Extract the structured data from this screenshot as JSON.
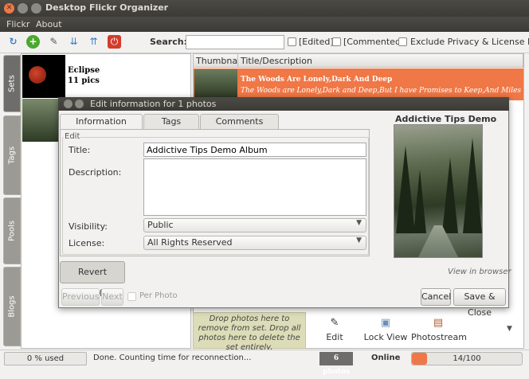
{
  "window": {
    "title": "Desktop Flickr Organizer"
  },
  "menu": {
    "items": [
      "Flickr",
      "About"
    ]
  },
  "toolbar": {
    "search_label": "Search:",
    "search_value": "",
    "filters": [
      {
        "label": "[Edited]",
        "checked": false
      },
      {
        "label": "[Commented]",
        "checked": false
      },
      {
        "label": "Exclude Privacy & License Info",
        "checked": false
      }
    ],
    "icons": [
      "refresh-icon",
      "add-icon",
      "edit-pencil-icon",
      "sort-down-icon",
      "sort-up-icon",
      "quit-icon"
    ]
  },
  "side_tabs": [
    "Sets",
    "Tags",
    "Pools",
    "Blogs"
  ],
  "sets": [
    {
      "name": "Eclipse",
      "count": "11 pics"
    }
  ],
  "table": {
    "columns": [
      "Thumbnail",
      "Title/Description"
    ],
    "selected_row": {
      "title": "The Woods Are Lonely,Dark And Deep",
      "description": "The Woods are Lonely,Dark and Deep,But I have Promises to Keep,And Miles to Go befor"
    }
  },
  "dialog": {
    "title": "Edit information for 1 photos",
    "tabs": [
      "Information",
      "Tags",
      "Comments"
    ],
    "active_tab": "Information",
    "frame_label": "Edit",
    "fields": {
      "title_label": "Title:",
      "title_value": "Addictive Tips Demo Album",
      "description_label": "Description:",
      "description_value": "",
      "visibility_label": "Visibility:",
      "visibility_value": "Public",
      "license_label": "License:",
      "license_value": "All Rights Reserved"
    },
    "preview_title": "Addictive Tips Demo Album",
    "view_in_browser": "View in browser",
    "buttons": {
      "revert": "Revert Photo(s)",
      "previous": "Previous",
      "next": "Next",
      "per_photo": "Per Photo",
      "cancel": "Cancel",
      "save_close": "Save & Close"
    }
  },
  "bottom": {
    "drop_zone": "Drop photos here to remove from set. Drop all photos here to delete the set entirely.",
    "tools": [
      {
        "label": "Edit",
        "icon": "edit-pencil-icon"
      },
      {
        "label": "Lock View",
        "icon": "lock-view-icon"
      },
      {
        "label": "Photostream",
        "icon": "photostream-icon"
      }
    ]
  },
  "status": {
    "usage": "0 % used",
    "message": "Done. Counting time for reconnection...",
    "photo_count": "6 photos",
    "connection": "Online",
    "progress_text": "14/100",
    "progress_fraction": 0.14
  },
  "colors": {
    "accent": "#f07746",
    "titlebar": "#3c3b37",
    "drop_zone": "#dcdcb8"
  }
}
